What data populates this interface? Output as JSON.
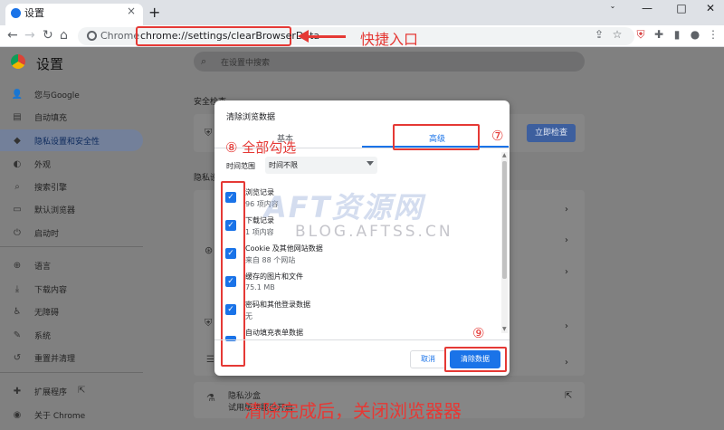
{
  "tab": {
    "title": "设置",
    "close": "×",
    "new_tab": "+"
  },
  "window": {
    "minimize": "—",
    "maximize": "□",
    "close": "✕"
  },
  "toolbar": {
    "chip_label": "Chrome",
    "url": "chrome://settings/clearBrowserData"
  },
  "annotations": {
    "entry": "快捷入口",
    "step7": "⑦",
    "step8": "⑧ 全部勾选",
    "step9": "⑨",
    "bottom": "清除完成后，关闭浏览器器"
  },
  "watermark": {
    "main": "AFT资源网",
    "sub": "BLOG.AFTSS.CN"
  },
  "settings": {
    "title": "设置",
    "search_placeholder": "在设置中搜索",
    "sidebar": [
      {
        "label": "您与Google",
        "icon": "person-icon",
        "glyph": "👤"
      },
      {
        "label": "自动填充",
        "icon": "clipboard-icon",
        "glyph": "▤"
      },
      {
        "label": "隐私设置和安全性",
        "icon": "shield-icon",
        "glyph": "◆",
        "selected": true
      },
      {
        "label": "外观",
        "icon": "palette-icon",
        "glyph": "◐"
      },
      {
        "label": "搜索引擎",
        "icon": "search-icon",
        "glyph": "⌕"
      },
      {
        "label": "默认浏览器",
        "icon": "browser-icon",
        "glyph": "▭"
      },
      {
        "label": "启动时",
        "icon": "power-icon",
        "glyph": "⏻"
      },
      {
        "label": "语言",
        "icon": "globe-icon",
        "glyph": "⊕"
      },
      {
        "label": "下载内容",
        "icon": "download-icon",
        "glyph": "⤓"
      },
      {
        "label": "无障碍",
        "icon": "accessibility-icon",
        "glyph": "♿"
      },
      {
        "label": "系统",
        "icon": "wrench-icon",
        "glyph": "✎"
      },
      {
        "label": "重置并清理",
        "icon": "reset-icon",
        "glyph": "↺"
      },
      {
        "label": "扩展程序",
        "icon": "puzzle-icon",
        "glyph": "✚"
      },
      {
        "label": "关于 Chrome",
        "icon": "chrome-icon",
        "glyph": "◉"
      }
    ],
    "safety_title": "安全检查",
    "safety_button": "立即检查",
    "privacy_title": "隐私设",
    "sandbox_title": "隐私沙盒",
    "sandbox_sub": "试用版功能已开启"
  },
  "dialog": {
    "title": "清除浏览数据",
    "tab_basic": "基本",
    "tab_advanced": "高级",
    "time_label": "时间范围",
    "time_value": "时间不限",
    "items": [
      {
        "name": "浏览记录",
        "sub": "96 项内容"
      },
      {
        "name": "下载记录",
        "sub": "1 项内容"
      },
      {
        "name": "Cookie 及其他网站数据",
        "sub": "来自 88 个网站"
      },
      {
        "name": "缓存的图片和文件",
        "sub": "75.1 MB"
      },
      {
        "name": "密码和其他登录数据",
        "sub": "无"
      },
      {
        "name": "自动填充表单数据",
        "sub": ""
      }
    ],
    "cancel": "取消",
    "clear": "清除数据"
  }
}
